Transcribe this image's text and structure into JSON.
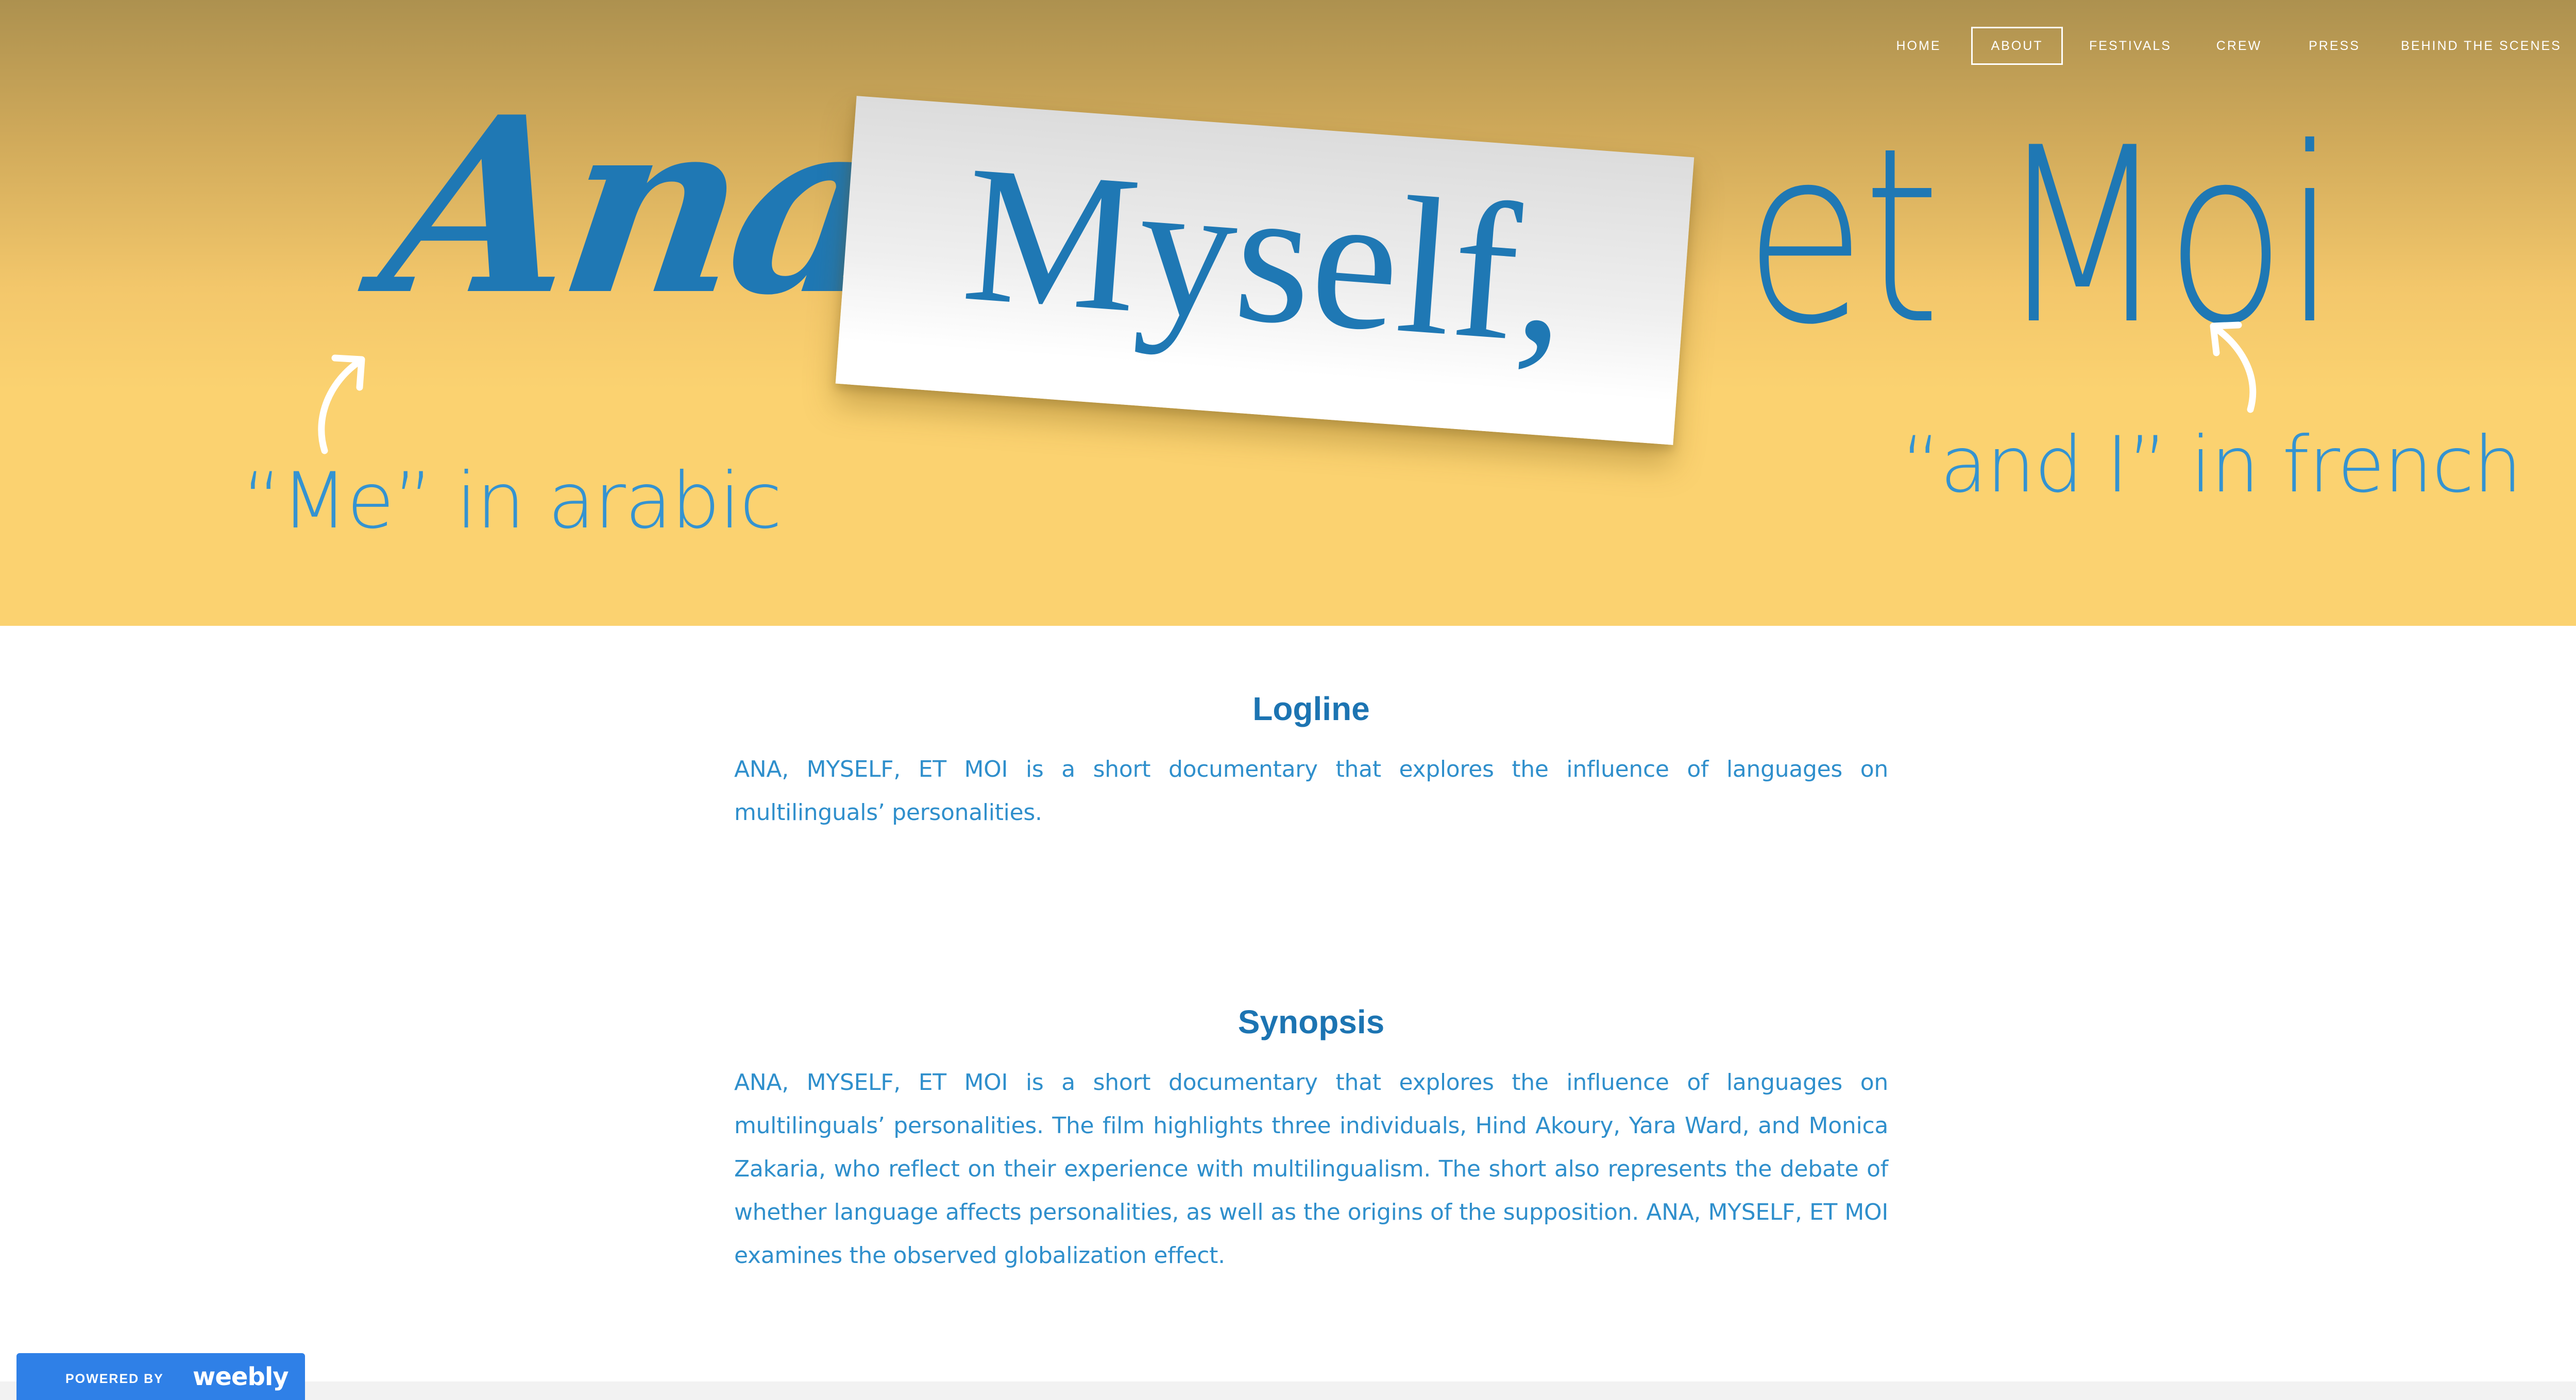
{
  "nav": {
    "items": [
      {
        "label": "HOME"
      },
      {
        "label": "ABOUT",
        "active": true
      },
      {
        "label": "FESTIVALS"
      },
      {
        "label": "CREW"
      },
      {
        "label": "PRESS"
      },
      {
        "label": "BEHIND THE SCENES"
      }
    ]
  },
  "hero": {
    "word_ana": "Ana,",
    "word_myself": "Myself,",
    "word_etmoi": "et Moi",
    "annotation_left": "“Me” in arabic",
    "annotation_right": "“and I” in french",
    "icons": [
      "curved-arrow-icon",
      "curved-arrow-icon"
    ]
  },
  "logline": {
    "heading": "Logline",
    "text": "ANA, MYSELF, ET MOI is a short documentary that explores the influence of languages on multilinguals’ personalities."
  },
  "synopsis": {
    "heading": "Synopsis",
    "text": "ANA, MYSELF, ET MOI is a short documentary that explores the influence of languages on multilinguals’ personalities. The film highlights three individuals, Hind Akoury, Yara Ward, and Monica Zakaria, who reflect on their experience with multilingualism. The short also represents the debate of whether language affects personalities, as well as the origins of the supposition. ANA, MYSELF, ET MOI examines the observed globalization effect."
  },
  "badge": {
    "powered_by": "POWERED BY",
    "brand": "weebly"
  },
  "colors": {
    "hero_top": "#ad914f",
    "hero_bottom": "#fbd270",
    "title_blue": "#1f78b4",
    "text_blue": "#2f8fcc",
    "badge_blue": "#2f80e7"
  }
}
